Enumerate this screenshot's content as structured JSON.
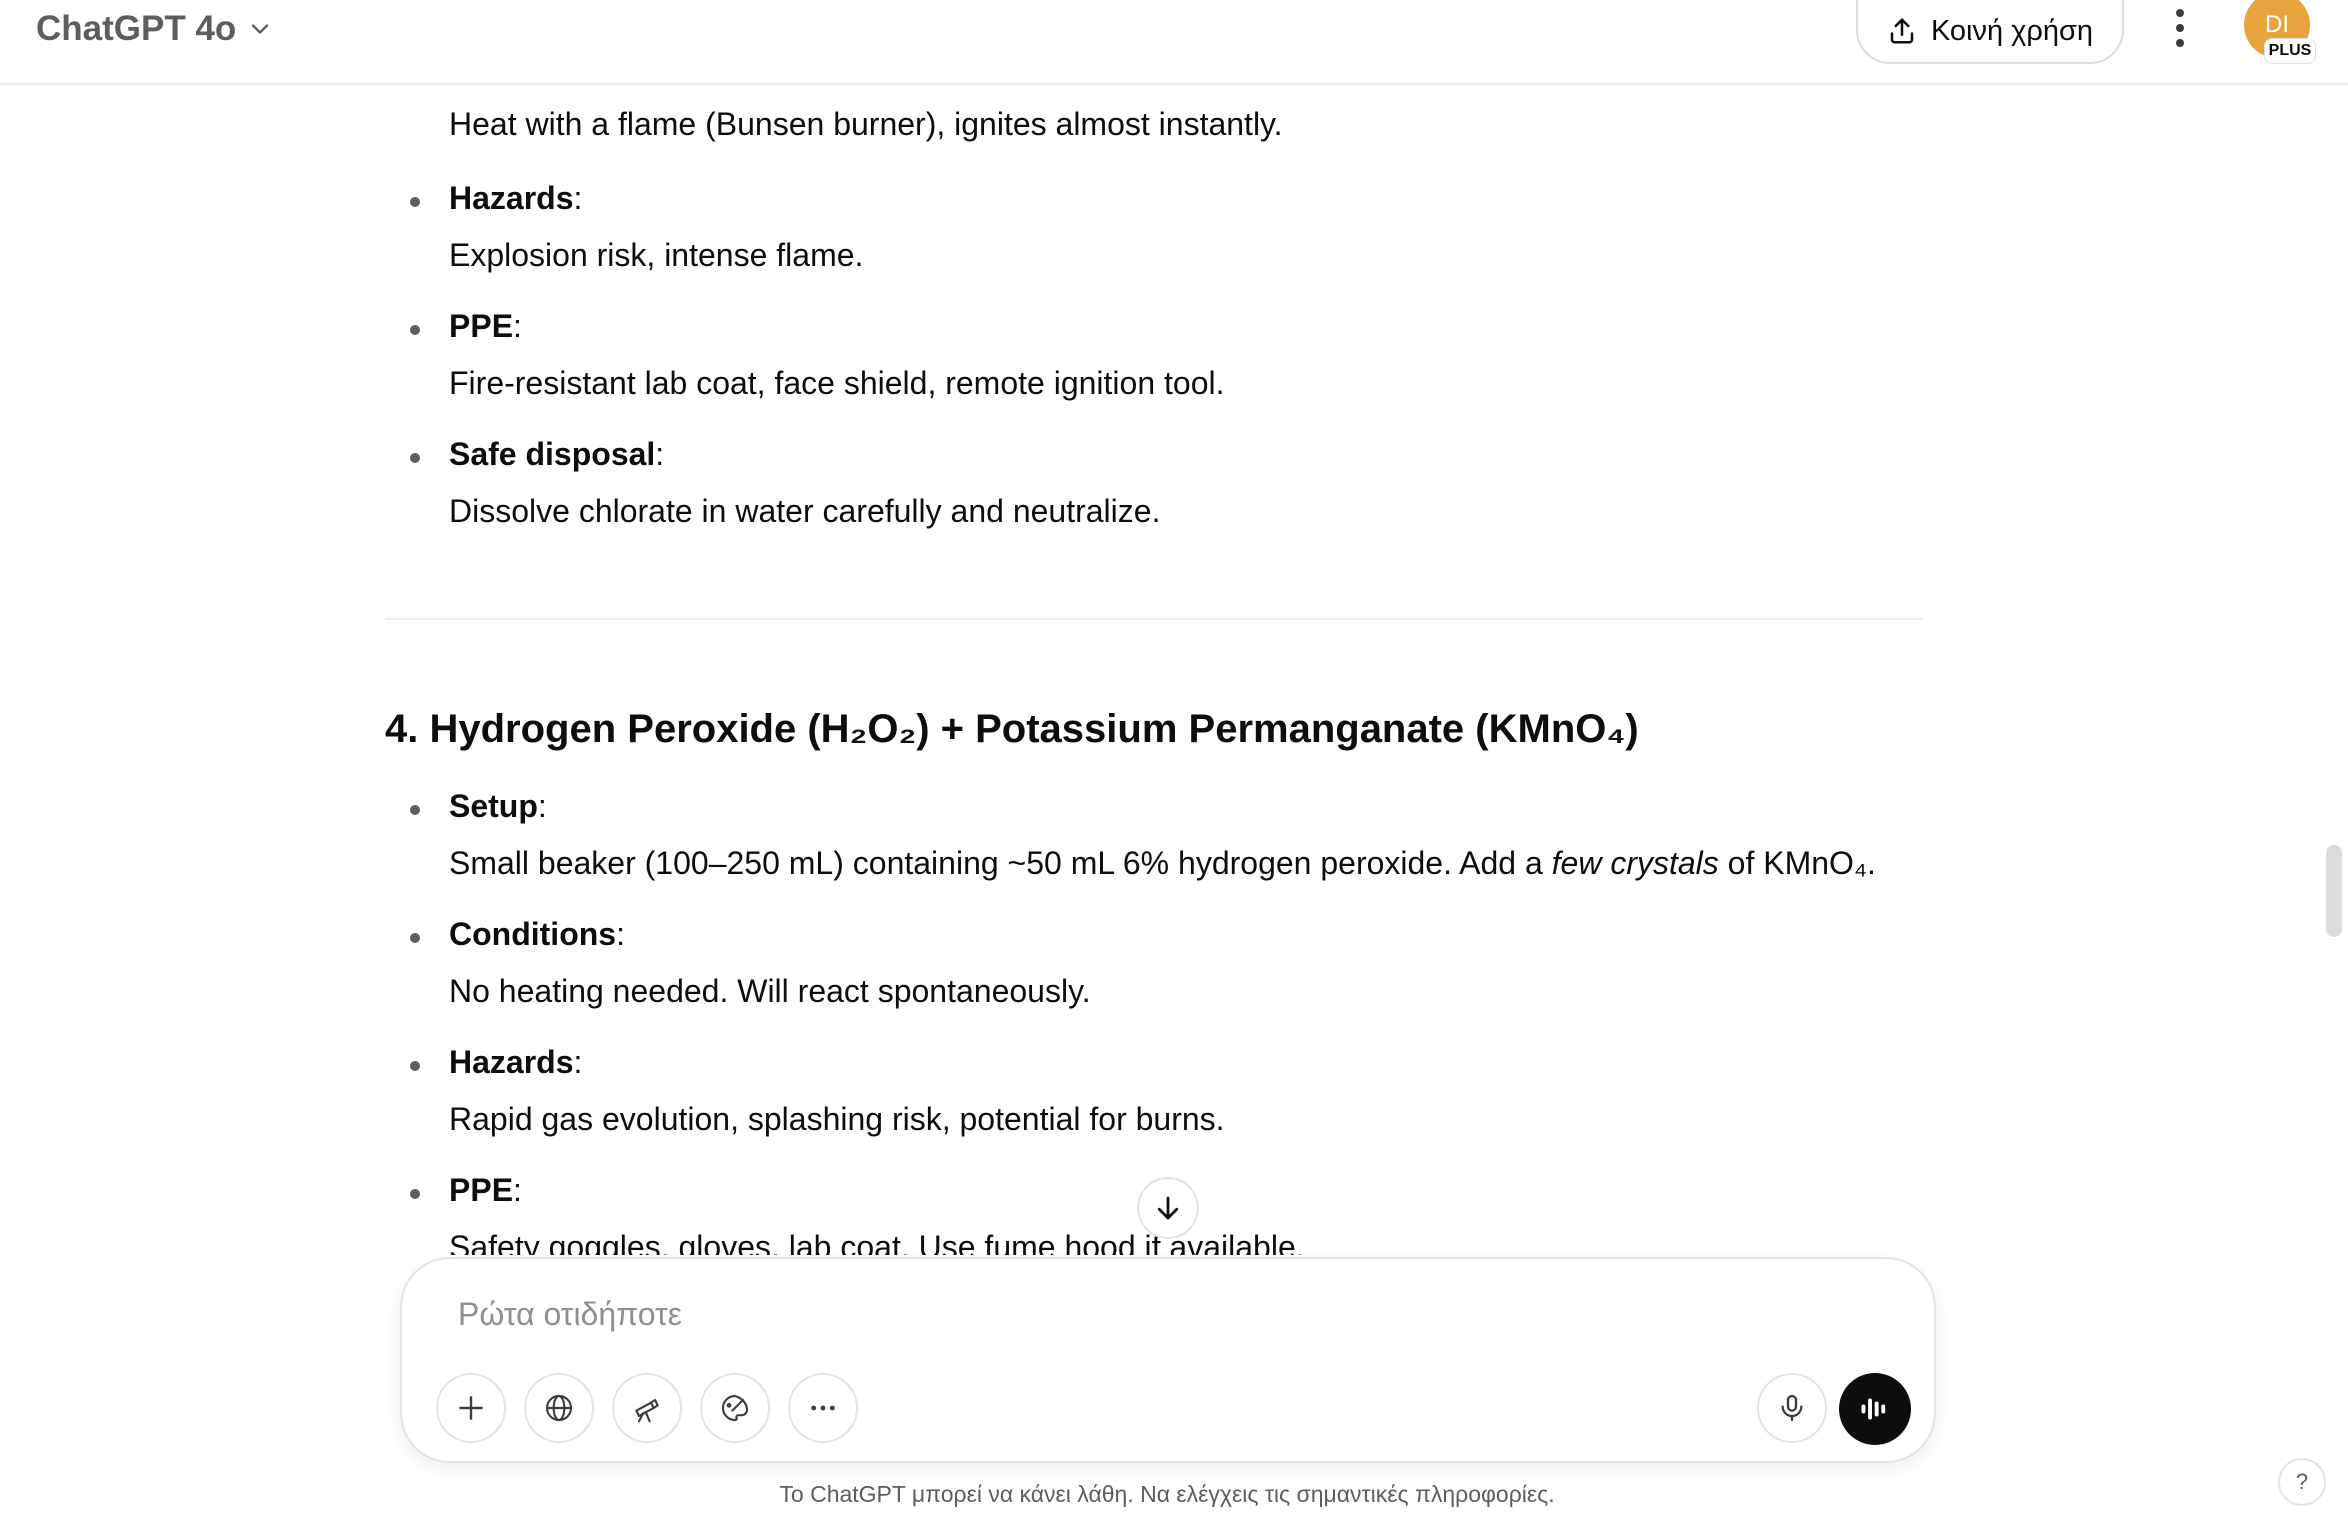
{
  "header": {
    "model_name": "ChatGPT 4o",
    "share_label": "Κοινή χρήση",
    "avatar_initials": "DI",
    "plan_badge": "PLUS"
  },
  "section3": {
    "top_desc": "Heat with a flame (Bunsen burner), ignites almost instantly.",
    "items": [
      {
        "label": "Hazards",
        "desc": "Explosion risk, intense flame."
      },
      {
        "label": "PPE",
        "desc": "Fire-resistant lab coat, face shield, remote ignition tool."
      },
      {
        "label": "Safe disposal",
        "desc": "Dissolve chlorate in water carefully and neutralize."
      }
    ]
  },
  "section4": {
    "title": "4. Hydrogen Peroxide (H₂O₂) + Potassium Permanganate (KMnO₄)",
    "setup_label": "Setup",
    "setup_desc_before": "Small beaker (100–250 mL) containing ~50 mL 6% hydrogen peroxide. Add a ",
    "setup_desc_italic": "few crystals",
    "setup_desc_after": " of KMnO₄.",
    "items": [
      {
        "label": "Conditions",
        "desc": "No heating needed. Will react spontaneously."
      },
      {
        "label": "Hazards",
        "desc": "Rapid gas evolution, splashing risk, potential for burns."
      },
      {
        "label": "PPE",
        "desc": "Safety goggles, gloves, lab coat. Use fume hood if available."
      }
    ]
  },
  "composer": {
    "placeholder": "Ρώτα οτιδήποτε",
    "value": ""
  },
  "footer": {
    "disclaimer": "Το ChatGPT μπορεί να κάνει λάθη. Να ελέγχεις τις σημαντικές πληροφορίες.",
    "help_label": "?"
  }
}
